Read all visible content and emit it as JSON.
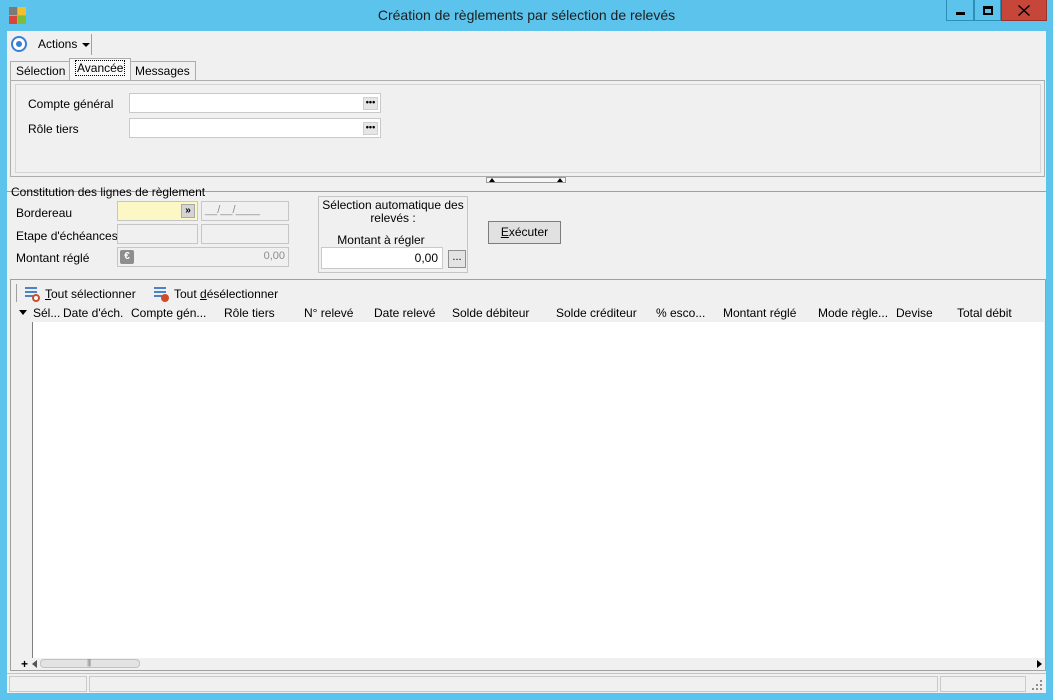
{
  "window": {
    "title": "Création de règlements par sélection de relevés",
    "accent_color": "#5cc3ec",
    "close_color": "#c7463a"
  },
  "toolbar": {
    "actions_label": "Actions"
  },
  "tabs": [
    {
      "label": "Sélection",
      "active": false
    },
    {
      "label": "Avancée",
      "active": true
    },
    {
      "label": "Messages",
      "active": false
    }
  ],
  "advanced": {
    "compte_general_label": "Compte général",
    "compte_general_value": "",
    "role_tiers_label": "Rôle tiers",
    "role_tiers_value": ""
  },
  "constitution": {
    "group_title": "Constitution des lignes de règlement",
    "bordereau_label": "Bordereau",
    "bordereau_value": "",
    "bordereau_date": "__/__/____",
    "etape_label": "Etape d'échéances",
    "montant_regle_label": "Montant réglé",
    "montant_regle_value": "0,00",
    "currency_icon": "€"
  },
  "auto_selection": {
    "title": "Sélection automatique des relevés :",
    "montant_label": "Montant à régler",
    "montant_value": "0,00",
    "ellipsis_label": "..."
  },
  "execute_button": {
    "label_prefix": "",
    "label_underlined": "E",
    "label_rest": "xécuter"
  },
  "grid": {
    "select_all_underlined": "T",
    "select_all_rest": "out sélectionner",
    "deselect_all_prefix": "Tout ",
    "deselect_all_underlined": "d",
    "deselect_all_rest": "ésélectionner",
    "columns": [
      "Sél...",
      "Date d'éch.",
      "Compte gén...",
      "Rôle tiers",
      "N° relevé",
      "Date relevé",
      "Solde débiteur",
      "Solde créditeur",
      "% esco...",
      "Montant réglé",
      "Mode règle...",
      "Devise",
      "Total débit"
    ],
    "add_label": "+"
  }
}
